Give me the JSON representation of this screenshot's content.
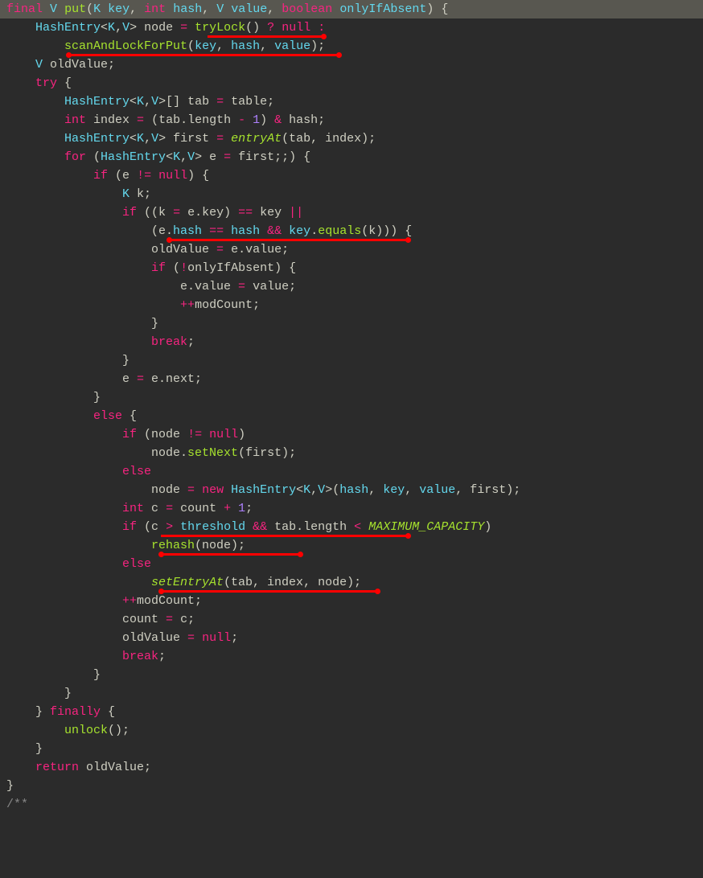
{
  "colors": {
    "background": "#2b2b2b",
    "highlight_row": "#585750",
    "keyword": "#f72480",
    "type": "#64d8ed",
    "method": "#a6e22e",
    "number": "#ae81ff",
    "text": "#cfcfc2",
    "comment": "#868686",
    "underline": "#ff0000"
  },
  "annotations": [
    {
      "kind": "underline",
      "line": 2,
      "text": "tryLock()",
      "note": "red underline with dot"
    },
    {
      "kind": "underline",
      "line": 3,
      "text": "scanAndLockForPut(key, hash, value)",
      "note": "red underline with dots"
    },
    {
      "kind": "underline",
      "line": 14,
      "text": "e.hash == hash && key.equals(k)",
      "note": "red underline with dots"
    },
    {
      "kind": "underline",
      "line": 30,
      "text": "c > threshold && tab.length < MAXIMUM_CAPACITY",
      "note": "red underline with dot (right)"
    },
    {
      "kind": "underline",
      "line": 31,
      "text": "rehash(node)",
      "note": "red underline with dots"
    },
    {
      "kind": "underline",
      "line": 33,
      "text": "setEntryAt(tab, index, node)",
      "note": "red underline with dots"
    }
  ],
  "code_lines": [
    {
      "n": 1,
      "raw": "final V put(K key, int hash, V value, boolean onlyIfAbsent) {",
      "tokens": [
        [
          "kw",
          "final"
        ],
        [
          "txt",
          " "
        ],
        [
          "typ",
          "V"
        ],
        [
          "txt",
          " "
        ],
        [
          "mth",
          "put"
        ],
        [
          "txt",
          "("
        ],
        [
          "typ",
          "K"
        ],
        [
          "txt",
          " "
        ],
        [
          "id",
          "key"
        ],
        [
          "txt",
          ", "
        ],
        [
          "kw",
          "int"
        ],
        [
          "txt",
          " "
        ],
        [
          "id",
          "hash"
        ],
        [
          "txt",
          ", "
        ],
        [
          "typ",
          "V"
        ],
        [
          "txt",
          " "
        ],
        [
          "id",
          "value"
        ],
        [
          "txt",
          ", "
        ],
        [
          "kw",
          "boolean"
        ],
        [
          "txt",
          " "
        ],
        [
          "id",
          "onlyIfAbsent"
        ],
        [
          "txt",
          ") {"
        ]
      ]
    },
    {
      "n": 2,
      "raw": "    HashEntry<K,V> node = tryLock() ? null :",
      "tokens": [
        [
          "txt",
          "    "
        ],
        [
          "typ",
          "HashEntry"
        ],
        [
          "txt",
          "<"
        ],
        [
          "typ",
          "K"
        ],
        [
          "txt",
          ","
        ],
        [
          "typ",
          "V"
        ],
        [
          "txt",
          "> node "
        ],
        [
          "kw",
          "="
        ],
        [
          "txt",
          " "
        ],
        [
          "mth",
          "tryLock"
        ],
        [
          "txt",
          "() "
        ],
        [
          "kw",
          "?"
        ],
        [
          "txt",
          " "
        ],
        [
          "kw",
          "null"
        ],
        [
          "txt",
          " "
        ],
        [
          "kw",
          ":"
        ]
      ]
    },
    {
      "n": 3,
      "raw": "        scanAndLockForPut(key, hash, value);",
      "tokens": [
        [
          "txt",
          "        "
        ],
        [
          "mth",
          "scanAndLockForPut"
        ],
        [
          "txt",
          "("
        ],
        [
          "id",
          "key"
        ],
        [
          "txt",
          ", "
        ],
        [
          "id",
          "hash"
        ],
        [
          "txt",
          ", "
        ],
        [
          "id",
          "value"
        ],
        [
          "txt",
          ");"
        ]
      ]
    },
    {
      "n": 4,
      "raw": "    V oldValue;",
      "tokens": [
        [
          "txt",
          "    "
        ],
        [
          "typ",
          "V"
        ],
        [
          "txt",
          " oldValue;"
        ]
      ]
    },
    {
      "n": 5,
      "raw": "    try {",
      "tokens": [
        [
          "txt",
          "    "
        ],
        [
          "kw",
          "try"
        ],
        [
          "txt",
          " {"
        ]
      ]
    },
    {
      "n": 6,
      "raw": "        HashEntry<K,V>[] tab = table;",
      "tokens": [
        [
          "txt",
          "        "
        ],
        [
          "typ",
          "HashEntry"
        ],
        [
          "txt",
          "<"
        ],
        [
          "typ",
          "K"
        ],
        [
          "txt",
          ","
        ],
        [
          "typ",
          "V"
        ],
        [
          "txt",
          ">[] tab "
        ],
        [
          "kw",
          "="
        ],
        [
          "txt",
          " table;"
        ]
      ]
    },
    {
      "n": 7,
      "raw": "        int index = (tab.length - 1) & hash;",
      "tokens": [
        [
          "txt",
          "        "
        ],
        [
          "kw",
          "int"
        ],
        [
          "txt",
          " index "
        ],
        [
          "kw",
          "="
        ],
        [
          "txt",
          " (tab.length "
        ],
        [
          "kw",
          "-"
        ],
        [
          "txt",
          " "
        ],
        [
          "num",
          "1"
        ],
        [
          "txt",
          ") "
        ],
        [
          "kw",
          "&"
        ],
        [
          "txt",
          " hash;"
        ]
      ]
    },
    {
      "n": 8,
      "raw": "        HashEntry<K,V> first = entryAt(tab, index);",
      "tokens": [
        [
          "txt",
          "        "
        ],
        [
          "typ",
          "HashEntry"
        ],
        [
          "txt",
          "<"
        ],
        [
          "typ",
          "K"
        ],
        [
          "txt",
          ","
        ],
        [
          "typ",
          "V"
        ],
        [
          "txt",
          "> first "
        ],
        [
          "kw",
          "="
        ],
        [
          "txt",
          " "
        ],
        [
          "it",
          "entryAt"
        ],
        [
          "txt",
          "(tab, index);"
        ]
      ]
    },
    {
      "n": 9,
      "raw": "        for (HashEntry<K,V> e = first;;) {",
      "tokens": [
        [
          "txt",
          "        "
        ],
        [
          "kw",
          "for"
        ],
        [
          "txt",
          " ("
        ],
        [
          "typ",
          "HashEntry"
        ],
        [
          "txt",
          "<"
        ],
        [
          "typ",
          "K"
        ],
        [
          "txt",
          ","
        ],
        [
          "typ",
          "V"
        ],
        [
          "txt",
          "> e "
        ],
        [
          "kw",
          "="
        ],
        [
          "txt",
          " first;;) {"
        ]
      ]
    },
    {
      "n": 10,
      "raw": "            if (e != null) {",
      "tokens": [
        [
          "txt",
          "            "
        ],
        [
          "kw",
          "if"
        ],
        [
          "txt",
          " (e "
        ],
        [
          "kw",
          "!="
        ],
        [
          "txt",
          " "
        ],
        [
          "kw",
          "null"
        ],
        [
          "txt",
          ") {"
        ]
      ]
    },
    {
      "n": 11,
      "raw": "                K k;",
      "tokens": [
        [
          "txt",
          "                "
        ],
        [
          "typ",
          "K"
        ],
        [
          "txt",
          " k;"
        ]
      ]
    },
    {
      "n": 12,
      "raw": "                if ((k = e.key) == key ||",
      "tokens": [
        [
          "txt",
          "                "
        ],
        [
          "kw",
          "if"
        ],
        [
          "txt",
          " ((k "
        ],
        [
          "kw",
          "="
        ],
        [
          "txt",
          " e.key) "
        ],
        [
          "kw",
          "=="
        ],
        [
          "txt",
          " key "
        ],
        [
          "kw",
          "||"
        ]
      ]
    },
    {
      "n": 13,
      "raw": "                    (e.hash == hash && key.equals(k))) {",
      "tokens": [
        [
          "txt",
          "                    (e."
        ],
        [
          "id",
          "hash"
        ],
        [
          "txt",
          " "
        ],
        [
          "kw",
          "=="
        ],
        [
          "txt",
          " "
        ],
        [
          "id",
          "hash"
        ],
        [
          "txt",
          " "
        ],
        [
          "kw",
          "&&"
        ],
        [
          "txt",
          " "
        ],
        [
          "id",
          "key"
        ],
        [
          "txt",
          "."
        ],
        [
          "mth",
          "equals"
        ],
        [
          "txt",
          "(k))) {"
        ]
      ]
    },
    {
      "n": 14,
      "raw": "                    oldValue = e.value;",
      "tokens": [
        [
          "txt",
          "                    oldValue "
        ],
        [
          "kw",
          "="
        ],
        [
          "txt",
          " e.value;"
        ]
      ]
    },
    {
      "n": 15,
      "raw": "                    if (!onlyIfAbsent) {",
      "tokens": [
        [
          "txt",
          "                    "
        ],
        [
          "kw",
          "if"
        ],
        [
          "txt",
          " ("
        ],
        [
          "kw",
          "!"
        ],
        [
          "txt",
          "onlyIfAbsent) {"
        ]
      ]
    },
    {
      "n": 16,
      "raw": "                        e.value = value;",
      "tokens": [
        [
          "txt",
          "                        e.value "
        ],
        [
          "kw",
          "="
        ],
        [
          "txt",
          " value;"
        ]
      ]
    },
    {
      "n": 17,
      "raw": "                        ++modCount;",
      "tokens": [
        [
          "txt",
          "                        "
        ],
        [
          "kw",
          "++"
        ],
        [
          "txt",
          "modCount;"
        ]
      ]
    },
    {
      "n": 18,
      "raw": "                    }",
      "tokens": [
        [
          "txt",
          "                    }"
        ]
      ]
    },
    {
      "n": 19,
      "raw": "                    break;",
      "tokens": [
        [
          "txt",
          "                    "
        ],
        [
          "kw",
          "break"
        ],
        [
          "txt",
          ";"
        ]
      ]
    },
    {
      "n": 20,
      "raw": "                }",
      "tokens": [
        [
          "txt",
          "                }"
        ]
      ]
    },
    {
      "n": 21,
      "raw": "                e = e.next;",
      "tokens": [
        [
          "txt",
          "                e "
        ],
        [
          "kw",
          "="
        ],
        [
          "txt",
          " e.next;"
        ]
      ]
    },
    {
      "n": 22,
      "raw": "            }",
      "tokens": [
        [
          "txt",
          "            }"
        ]
      ]
    },
    {
      "n": 23,
      "raw": "            else {",
      "tokens": [
        [
          "txt",
          "            "
        ],
        [
          "kw",
          "else"
        ],
        [
          "txt",
          " {"
        ]
      ]
    },
    {
      "n": 24,
      "raw": "                if (node != null)",
      "tokens": [
        [
          "txt",
          "                "
        ],
        [
          "kw",
          "if"
        ],
        [
          "txt",
          " (node "
        ],
        [
          "kw",
          "!="
        ],
        [
          "txt",
          " "
        ],
        [
          "kw",
          "null"
        ],
        [
          "txt",
          ")"
        ]
      ]
    },
    {
      "n": 25,
      "raw": "                    node.setNext(first);",
      "tokens": [
        [
          "txt",
          "                    node."
        ],
        [
          "mth",
          "setNext"
        ],
        [
          "txt",
          "(first);"
        ]
      ]
    },
    {
      "n": 26,
      "raw": "                else",
      "tokens": [
        [
          "txt",
          "                "
        ],
        [
          "kw",
          "else"
        ]
      ]
    },
    {
      "n": 27,
      "raw": "                    node = new HashEntry<K,V>(hash, key, value, first);",
      "tokens": [
        [
          "txt",
          "                    node "
        ],
        [
          "kw",
          "="
        ],
        [
          "txt",
          " "
        ],
        [
          "kw",
          "new"
        ],
        [
          "txt",
          " "
        ],
        [
          "typ",
          "HashEntry"
        ],
        [
          "txt",
          "<"
        ],
        [
          "typ",
          "K"
        ],
        [
          "txt",
          ","
        ],
        [
          "typ",
          "V"
        ],
        [
          "txt",
          ">("
        ],
        [
          "id",
          "hash"
        ],
        [
          "txt",
          ", "
        ],
        [
          "id",
          "key"
        ],
        [
          "txt",
          ", "
        ],
        [
          "id",
          "value"
        ],
        [
          "txt",
          ", first);"
        ]
      ]
    },
    {
      "n": 28,
      "raw": "                int c = count + 1;",
      "tokens": [
        [
          "txt",
          "                "
        ],
        [
          "kw",
          "int"
        ],
        [
          "txt",
          " c "
        ],
        [
          "kw",
          "="
        ],
        [
          "txt",
          " count "
        ],
        [
          "kw",
          "+"
        ],
        [
          "txt",
          " "
        ],
        [
          "num",
          "1"
        ],
        [
          "txt",
          ";"
        ]
      ]
    },
    {
      "n": 29,
      "raw": "                if (c > threshold && tab.length < MAXIMUM_CAPACITY)",
      "tokens": [
        [
          "txt",
          "                "
        ],
        [
          "kw",
          "if"
        ],
        [
          "txt",
          " (c "
        ],
        [
          "kw",
          ">"
        ],
        [
          "txt",
          " "
        ],
        [
          "id",
          "threshold"
        ],
        [
          "txt",
          " "
        ],
        [
          "kw",
          "&&"
        ],
        [
          "txt",
          " tab.length "
        ],
        [
          "kw",
          "<"
        ],
        [
          "txt",
          " "
        ],
        [
          "it",
          "MAXIMUM_CAPACITY"
        ],
        [
          "txt",
          ")"
        ]
      ]
    },
    {
      "n": 30,
      "raw": "                    rehash(node);",
      "tokens": [
        [
          "txt",
          "                    "
        ],
        [
          "mth",
          "rehash"
        ],
        [
          "txt",
          "(node);"
        ]
      ]
    },
    {
      "n": 31,
      "raw": "                else",
      "tokens": [
        [
          "txt",
          "                "
        ],
        [
          "kw",
          "else"
        ]
      ]
    },
    {
      "n": 32,
      "raw": "                    setEntryAt(tab, index, node);",
      "tokens": [
        [
          "txt",
          "                    "
        ],
        [
          "it",
          "setEntryAt"
        ],
        [
          "txt",
          "(tab, index, node);"
        ]
      ]
    },
    {
      "n": 33,
      "raw": "                ++modCount;",
      "tokens": [
        [
          "txt",
          "                "
        ],
        [
          "kw",
          "++"
        ],
        [
          "txt",
          "modCount;"
        ]
      ]
    },
    {
      "n": 34,
      "raw": "                count = c;",
      "tokens": [
        [
          "txt",
          "                count "
        ],
        [
          "kw",
          "="
        ],
        [
          "txt",
          " c;"
        ]
      ]
    },
    {
      "n": 35,
      "raw": "                oldValue = null;",
      "tokens": [
        [
          "txt",
          "                oldValue "
        ],
        [
          "kw",
          "="
        ],
        [
          "txt",
          " "
        ],
        [
          "kw",
          "null"
        ],
        [
          "txt",
          ";"
        ]
      ]
    },
    {
      "n": 36,
      "raw": "                break;",
      "tokens": [
        [
          "txt",
          "                "
        ],
        [
          "kw",
          "break"
        ],
        [
          "txt",
          ";"
        ]
      ]
    },
    {
      "n": 37,
      "raw": "            }",
      "tokens": [
        [
          "txt",
          "            }"
        ]
      ]
    },
    {
      "n": 38,
      "raw": "        }",
      "tokens": [
        [
          "txt",
          "        }"
        ]
      ]
    },
    {
      "n": 39,
      "raw": "    } finally {",
      "tokens": [
        [
          "txt",
          "    } "
        ],
        [
          "kw",
          "finally"
        ],
        [
          "txt",
          " {"
        ]
      ]
    },
    {
      "n": 40,
      "raw": "        unlock();",
      "tokens": [
        [
          "txt",
          "        "
        ],
        [
          "mth",
          "unlock"
        ],
        [
          "txt",
          "();"
        ]
      ]
    },
    {
      "n": 41,
      "raw": "    }",
      "tokens": [
        [
          "txt",
          "    }"
        ]
      ]
    },
    {
      "n": 42,
      "raw": "    return oldValue;",
      "tokens": [
        [
          "txt",
          "    "
        ],
        [
          "kw",
          "return"
        ],
        [
          "txt",
          " oldValue;"
        ]
      ]
    },
    {
      "n": 43,
      "raw": "}",
      "tokens": [
        [
          "txt",
          "}"
        ]
      ]
    },
    {
      "n": 44,
      "raw": "",
      "tokens": [
        [
          "txt",
          ""
        ]
      ]
    },
    {
      "n": 45,
      "raw": "/**",
      "tokens": [
        [
          "gry",
          "/**"
        ]
      ]
    }
  ]
}
